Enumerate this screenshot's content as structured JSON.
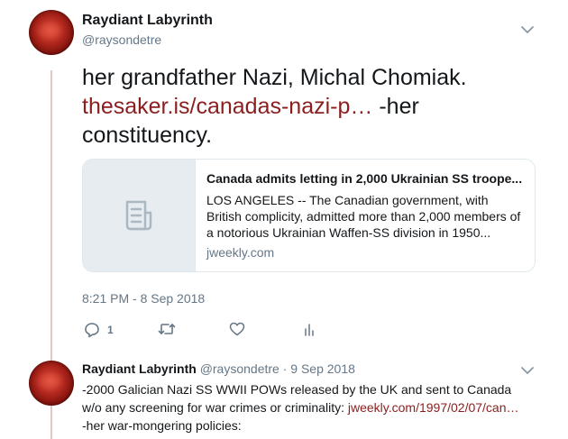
{
  "tweet": {
    "display_name": "Raydiant Labyrinth",
    "handle": "@raysondetre",
    "text_before": "her grandfather Nazi, Michal Chomiak. ",
    "link_text": "thesaker.is/canadas-nazi-p…",
    "text_after": " -her constituency.",
    "timestamp": "8:21 PM - 8 Sep 2018",
    "reply_count": "1",
    "accent_color": "#8b1e1e"
  },
  "card": {
    "title": "Canada admits letting in 2,000 Ukrainian SS troope...",
    "description": "LOS ANGELES -- The Canadian government, with British complicity, admitted more than 2,000 members of a notorious Ukrainian Waffen-SS division in 1950...",
    "domain": "jweekly.com",
    "thumb_icon": "document-icon"
  },
  "reply": {
    "display_name": "Raydiant Labyrinth",
    "handle_date": "@raysondetre · 9 Sep 2018",
    "text_before": "-2000 Galician Nazi SS WWII POWs released by the UK and sent to Canada w/o any screening for war crimes or criminality: ",
    "link_text": "jweekly.com/1997/02/07/can…",
    "text_after": " -her war-mongering policies:"
  }
}
